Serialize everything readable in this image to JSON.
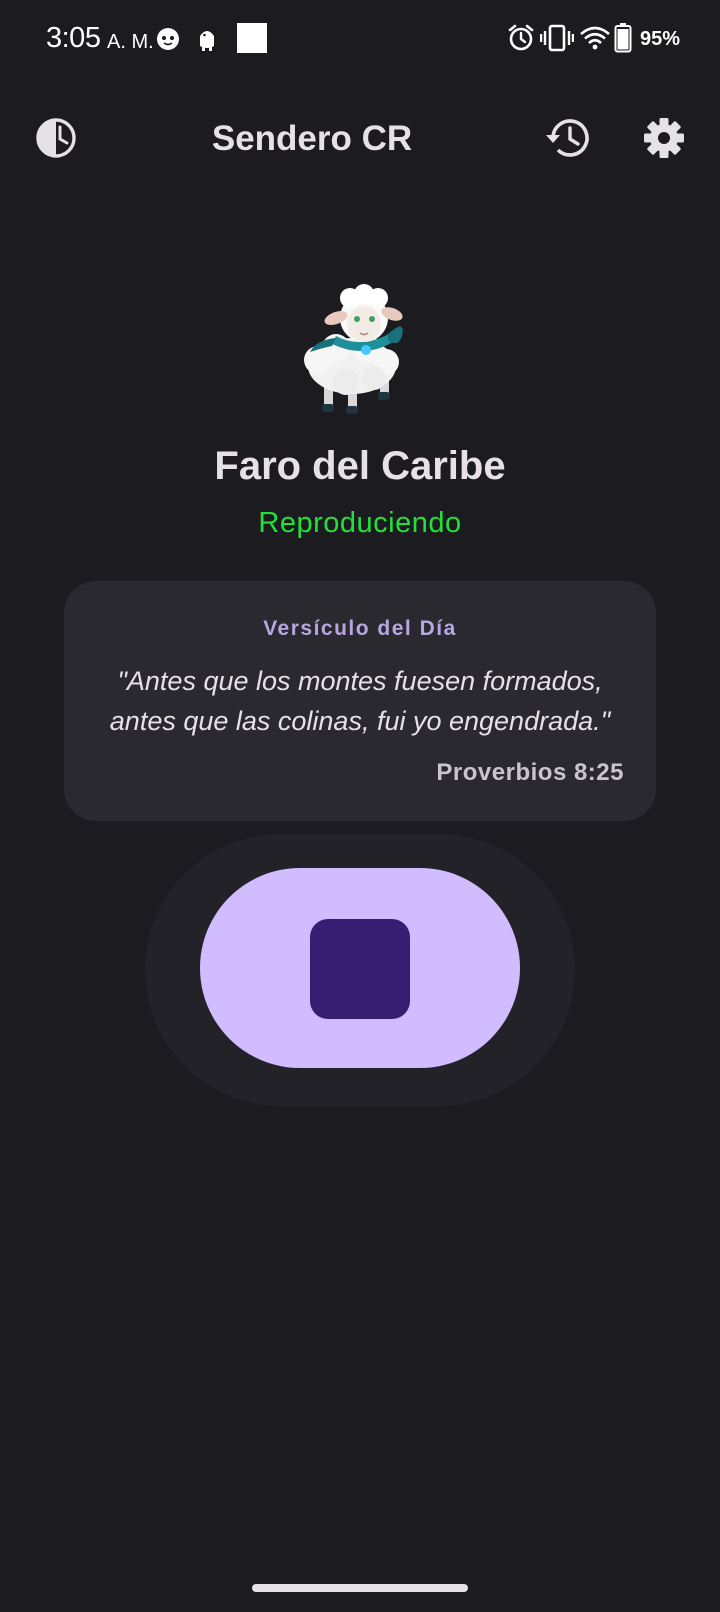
{
  "status_bar": {
    "time": "3:05",
    "ampm": "A. M.",
    "battery": "95%",
    "icons": [
      "cat-notification-icon",
      "android-notification-icon",
      "blank-notification-icon",
      "alarm-icon",
      "vibrate-icon",
      "wifi-icon",
      "battery-icon"
    ]
  },
  "app_bar": {
    "title": "Sendero CR",
    "left_icon": "sleep-timer-icon",
    "right_icons": [
      "history-icon",
      "settings-icon"
    ]
  },
  "station": {
    "mascot": "sheep-mascot",
    "name": "Faro del Caribe",
    "status": "Reproduciendo",
    "status_color": "#22e038"
  },
  "verse": {
    "heading": "Versículo del Día",
    "text": "\"Antes que los montes fuesen formados, antes que las colinas, fui yo engendrada.\"",
    "reference": "Proverbios 8:25"
  },
  "player": {
    "state": "playing",
    "button_icon": "stop-icon",
    "accent": "#d0bcff",
    "icon_color": "#381e72"
  }
}
